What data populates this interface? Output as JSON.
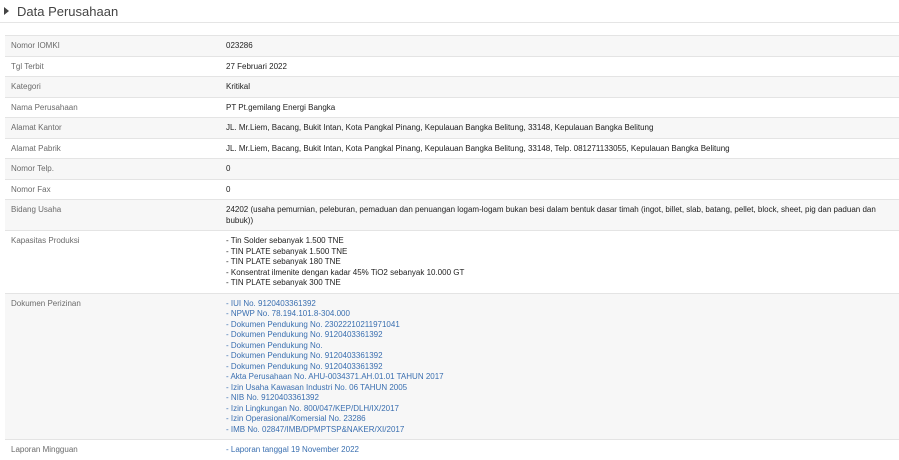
{
  "section": {
    "title": "Data Perusahaan"
  },
  "rows": {
    "nomor_iomki": {
      "label": "Nomor IOMKI",
      "value": "023286"
    },
    "tgl_terbit": {
      "label": "Tgl Terbit",
      "value": "27 Februari 2022"
    },
    "kategori": {
      "label": "Kategori",
      "value": "Kritikal"
    },
    "nama_perusahaan": {
      "label": "Nama Perusahaan",
      "value": "PT Pt.gemilang Energi Bangka"
    },
    "alamat_kantor": {
      "label": "Alamat Kantor",
      "value": "JL. Mr.Liem, Bacang, Bukit Intan, Kota Pangkal Pinang, Kepulauan Bangka Belitung, 33148, Kepulauan Bangka Belitung"
    },
    "alamat_pabrik": {
      "label": "Alamat Pabrik",
      "value": "JL. Mr.Liem, Bacang, Bukit Intan, Kota Pangkal Pinang, Kepulauan Bangka Belitung, 33148, Telp. 081271133055, Kepulauan Bangka Belitung"
    },
    "nomor_telp": {
      "label": "Nomor Telp.",
      "value": "0"
    },
    "nomor_fax": {
      "label": "Nomor Fax",
      "value": "0"
    },
    "bidang_usaha": {
      "label": "Bidang Usaha",
      "value": "24202 (usaha pemurnian, peleburan, pemaduan dan penuangan logam-logam bukan besi dalam bentuk dasar timah (ingot, billet, slab, batang, pellet, block, sheet, pig dan paduan dan bubuk))"
    },
    "kapasitas_produksi": {
      "label": "Kapasitas Produksi",
      "items": [
        "- Tin Solder sebanyak 1.500 TNE",
        "- TIN PLATE sebanyak 1.500 TNE",
        "- TIN PLATE sebanyak 180 TNE",
        "- Konsentrat ilmenite dengan kadar 45% TiO2 sebanyak 10.000 GT",
        "- TIN PLATE sebanyak 300 TNE"
      ]
    },
    "dokumen_perizinan": {
      "label": "Dokumen Perizinan",
      "items": [
        "- IUI No. 9120403361392",
        "- NPWP No. 78.194.101.8-304.000",
        "- Dokumen Pendukung No. 23022210211971041",
        "- Dokumen Pendukung No. 9120403361392",
        "- Dokumen Pendukung No.",
        "- Dokumen Pendukung No. 9120403361392",
        "- Dokumen Pendukung No. 9120403361392",
        "- Akta Perusahaan No. AHU-0034371.AH.01.01 TAHUN 2017",
        "- Izin Usaha Kawasan Industri No. 06 TAHUN 2005",
        "- NIB No. 9120403361392",
        "- Izin Lingkungan No. 800/047/KEP/DLH/IX/2017",
        "- Izin Operasional/Komersial No. 23286",
        "- IMB No. 02847/IMB/DPMPTSP&NAKER/XI/2017"
      ]
    },
    "laporan_mingguan": {
      "label": "Laporan Mingguan",
      "items": [
        "- Laporan tanggal 19 November 2022"
      ]
    }
  },
  "colors": {
    "link": "#3a6fb0",
    "stripe": "#f7f7f7",
    "border": "#e4e4e4"
  }
}
